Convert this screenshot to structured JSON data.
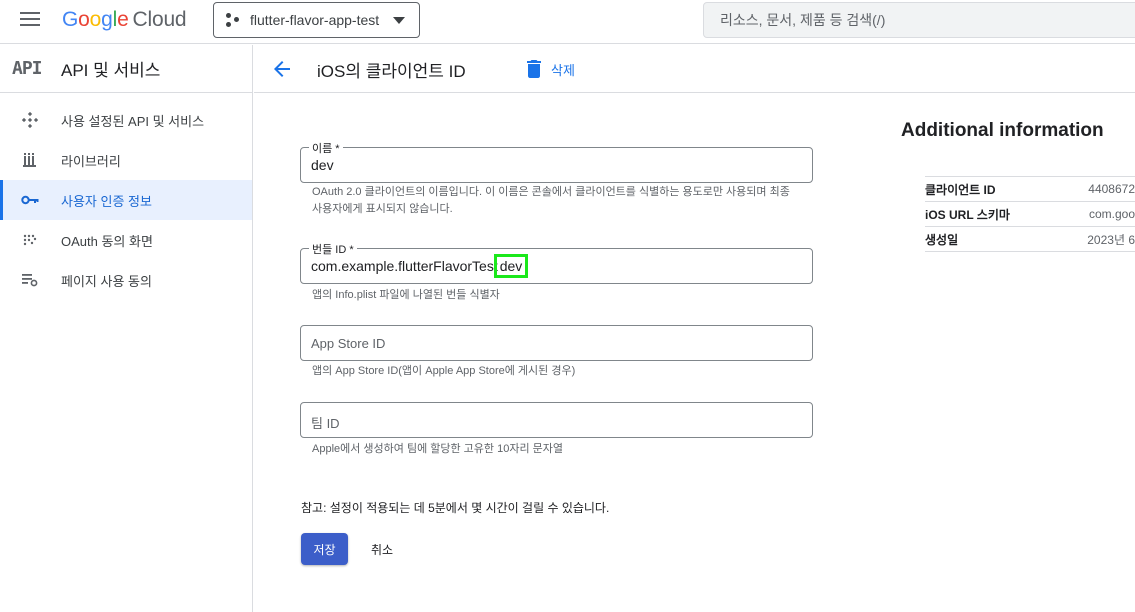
{
  "topbar": {
    "brand_google": "Google",
    "brand_cloud": "Cloud",
    "project_name": "flutter-flavor-app-test",
    "search_placeholder": "리소스, 문서, 제품 등 검색(/)"
  },
  "sidebar": {
    "section_mark": "API",
    "section_title": "API 및 서비스",
    "items": [
      {
        "label": "사용 설정된 API 및 서비스",
        "icon": "api-icon"
      },
      {
        "label": "라이브러리",
        "icon": "library-icon"
      },
      {
        "label": "사용자 인증 정보",
        "icon": "key-icon",
        "active": true
      },
      {
        "label": "OAuth 동의 화면",
        "icon": "consent-icon"
      },
      {
        "label": "페이지 사용 동의",
        "icon": "settings-list-icon"
      }
    ]
  },
  "header": {
    "title": "iOS의 클라이언트 ID",
    "delete_label": "삭제"
  },
  "form": {
    "name": {
      "label": "이름 *",
      "value": "dev",
      "hint": "OAuth 2.0 클라이언트의 이름입니다. 이 이름은 콘솔에서 클라이언트를 식별하는 용도로만 사용되며 최종 사용자에게 표시되지 않습니다."
    },
    "bundle": {
      "label": "번들 ID *",
      "value_prefix": "com.example.flutterFlavorTest",
      "value_suffix": "dev",
      "hint": "앱의 Info.plist 파일에 나열된 번들 식별자"
    },
    "appstore": {
      "placeholder": "App Store ID",
      "hint": "앱의 App Store ID(앱이 Apple App Store에 게시된 경우)"
    },
    "team": {
      "placeholder": "팀 ID",
      "hint": "Apple에서 생성하여 팀에 할당한 고유한 10자리 문자열"
    },
    "note": "참고: 설정이 적용되는 데 5분에서 몇 시간이 걸릴 수 있습니다.",
    "save_label": "저장",
    "cancel_label": "취소"
  },
  "additional": {
    "title": "Additional information",
    "rows": [
      {
        "key": "클라이언트 ID",
        "value": "4408672"
      },
      {
        "key": "iOS URL 스키마",
        "value": "com.goo"
      },
      {
        "key": "생성일",
        "value": "2023년 6"
      }
    ]
  },
  "colors": {
    "accent": "#1a73e8",
    "save_button": "#3c5ec9",
    "highlight_box": "#1be81b"
  }
}
